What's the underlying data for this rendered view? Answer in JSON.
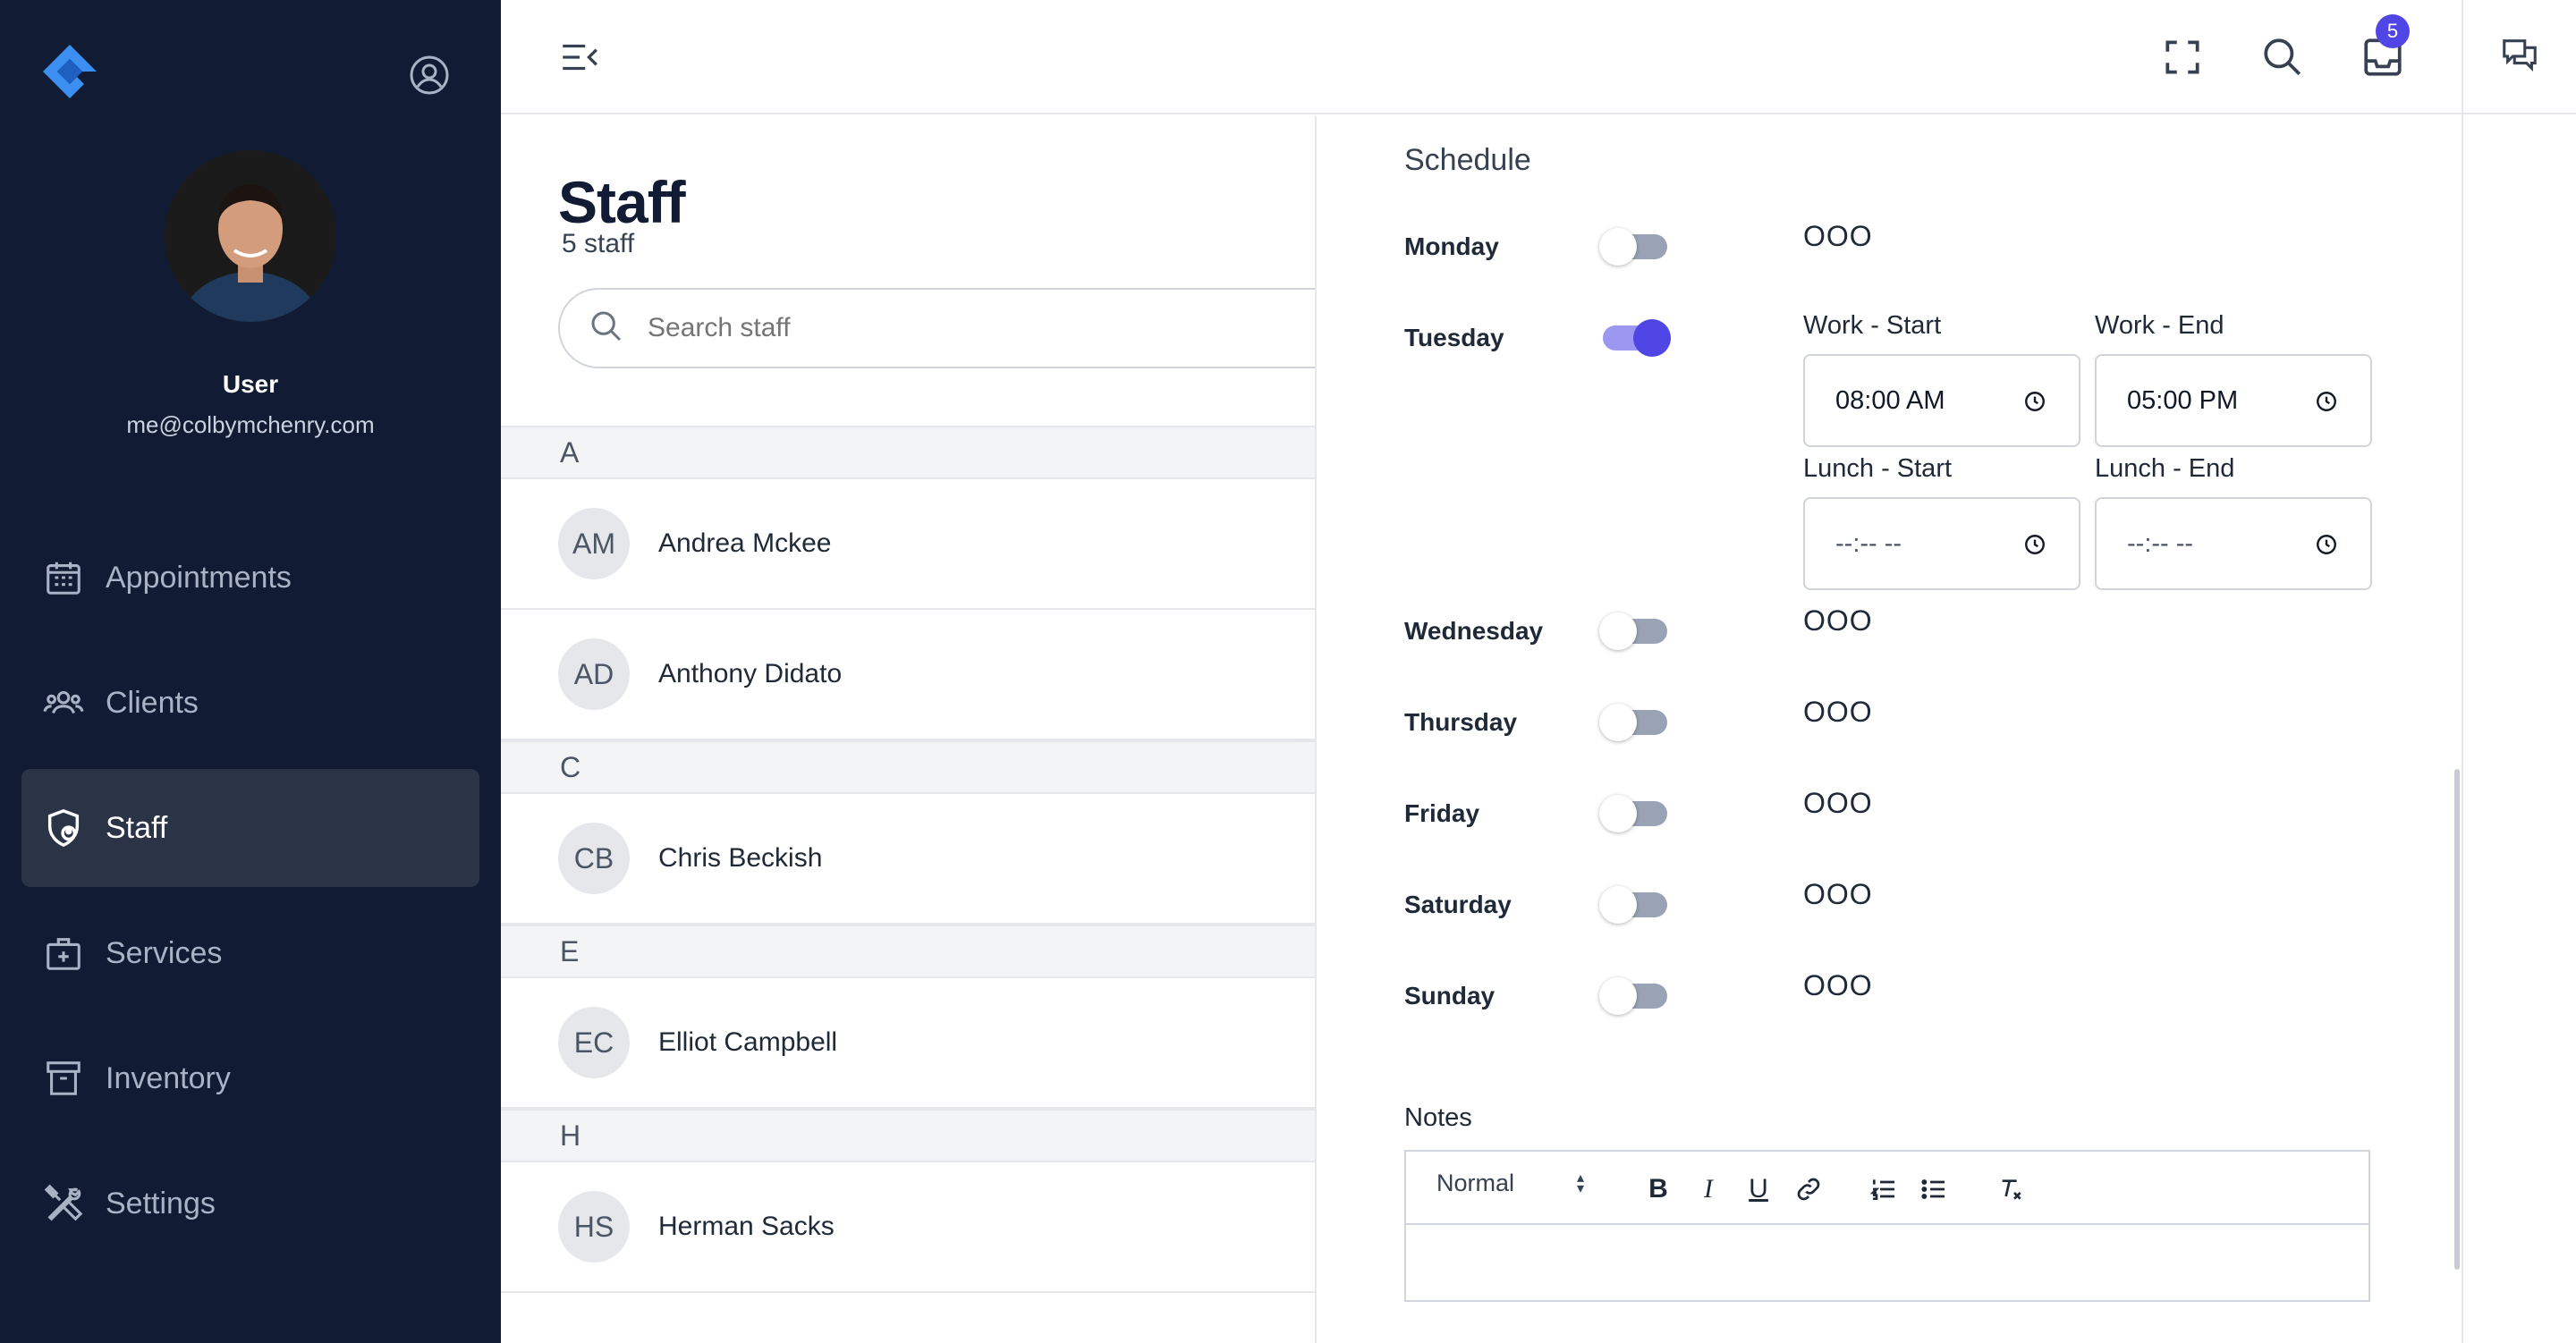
{
  "sidebar": {
    "user": {
      "name": "User",
      "email": "me@colbymchenry.com"
    },
    "items": [
      {
        "label": "Appointments",
        "icon": "calendar-icon"
      },
      {
        "label": "Clients",
        "icon": "users-icon"
      },
      {
        "label": "Staff",
        "icon": "shield-user-icon",
        "active": true
      },
      {
        "label": "Services",
        "icon": "medical-bag-icon"
      },
      {
        "label": "Inventory",
        "icon": "archive-box-icon"
      },
      {
        "label": "Settings",
        "icon": "tools-icon"
      }
    ]
  },
  "topbar": {
    "notification_count": "5"
  },
  "staff": {
    "title": "Staff",
    "count": "5 staff",
    "search_placeholder": "Search staff",
    "groups": [
      {
        "letter": "A",
        "members": [
          {
            "initials": "AM",
            "name": "Andrea Mckee"
          },
          {
            "initials": "AD",
            "name": "Anthony Didato"
          }
        ]
      },
      {
        "letter": "C",
        "members": [
          {
            "initials": "CB",
            "name": "Chris Beckish"
          }
        ]
      },
      {
        "letter": "E",
        "members": [
          {
            "initials": "EC",
            "name": "Elliot Campbell"
          }
        ]
      },
      {
        "letter": "H",
        "members": [
          {
            "initials": "HS",
            "name": "Herman Sacks"
          }
        ]
      }
    ]
  },
  "schedule": {
    "title": "Schedule",
    "days": [
      {
        "day": "Monday",
        "enabled": false,
        "status": "OOO"
      },
      {
        "day": "Tuesday",
        "enabled": true,
        "status": ""
      },
      {
        "day": "Wednesday",
        "enabled": false,
        "status": "OOO"
      },
      {
        "day": "Thursday",
        "enabled": false,
        "status": "OOO"
      },
      {
        "day": "Friday",
        "enabled": false,
        "status": "OOO"
      },
      {
        "day": "Saturday",
        "enabled": false,
        "status": "OOO"
      },
      {
        "day": "Sunday",
        "enabled": false,
        "status": "OOO"
      }
    ],
    "tuesday": {
      "work_start_label": "Work - Start",
      "work_end_label": "Work - End",
      "lunch_start_label": "Lunch - Start",
      "lunch_end_label": "Lunch - End",
      "work_start": "08:00 AM",
      "work_end": "05:00 PM",
      "lunch_start": "--:-- --",
      "lunch_end": "--:-- --"
    }
  },
  "notes": {
    "label": "Notes",
    "format": "Normal",
    "toolbar": {
      "bold": "B",
      "italic": "I",
      "underline": "U"
    }
  },
  "colors": {
    "sidebar_bg": "#111b33",
    "accent": "#4f46e5",
    "active_nav": "#2b3447"
  }
}
